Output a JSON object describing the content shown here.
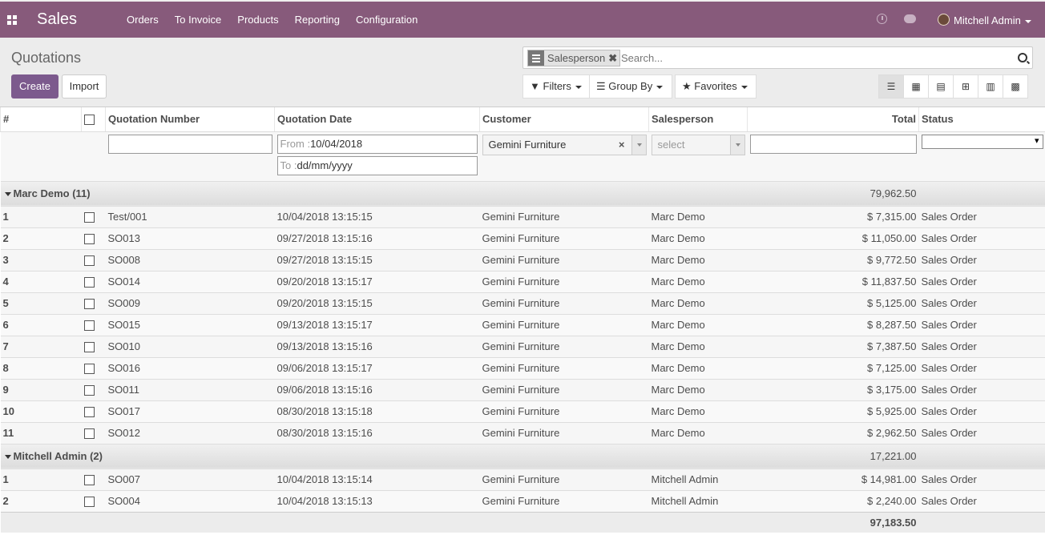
{
  "app": {
    "name": "Sales",
    "menu": [
      "Orders",
      "To Invoice",
      "Products",
      "Reporting",
      "Configuration"
    ],
    "user": "Mitchell Admin"
  },
  "page": {
    "title": "Quotations",
    "create": "Create",
    "import": "Import"
  },
  "search": {
    "facet": "Salesperson",
    "placeholder": "Search..."
  },
  "filters": {
    "filters": "Filters",
    "group_by": "Group By",
    "favorites": "Favorites"
  },
  "columns": {
    "num": "#",
    "number": "Quotation Number",
    "date": "Quotation Date",
    "customer": "Customer",
    "salesperson": "Salesperson",
    "total": "Total",
    "status": "Status"
  },
  "filter_row": {
    "from_label": "From :",
    "from_value": "10/04/2018",
    "to_label": "To :",
    "to_placeholder": "dd/mm/yyyy",
    "customer": "Gemini Furniture",
    "salesperson_placeholder": "select"
  },
  "groups": [
    {
      "name": "Marc Demo (11)",
      "total": "79,962.50",
      "rows": [
        {
          "n": "1",
          "ref": "Test/001",
          "date": "10/04/2018 13:15:15",
          "customer": "Gemini Furniture",
          "sp": "Marc Demo",
          "total": "$ 7,315.00",
          "status": "Sales Order"
        },
        {
          "n": "2",
          "ref": "SO013",
          "date": "09/27/2018 13:15:16",
          "customer": "Gemini Furniture",
          "sp": "Marc Demo",
          "total": "$ 11,050.00",
          "status": "Sales Order"
        },
        {
          "n": "3",
          "ref": "SO008",
          "date": "09/27/2018 13:15:15",
          "customer": "Gemini Furniture",
          "sp": "Marc Demo",
          "total": "$ 9,772.50",
          "status": "Sales Order"
        },
        {
          "n": "4",
          "ref": "SO014",
          "date": "09/20/2018 13:15:17",
          "customer": "Gemini Furniture",
          "sp": "Marc Demo",
          "total": "$ 11,837.50",
          "status": "Sales Order"
        },
        {
          "n": "5",
          "ref": "SO009",
          "date": "09/20/2018 13:15:15",
          "customer": "Gemini Furniture",
          "sp": "Marc Demo",
          "total": "$ 5,125.00",
          "status": "Sales Order"
        },
        {
          "n": "6",
          "ref": "SO015",
          "date": "09/13/2018 13:15:17",
          "customer": "Gemini Furniture",
          "sp": "Marc Demo",
          "total": "$ 8,287.50",
          "status": "Sales Order"
        },
        {
          "n": "7",
          "ref": "SO010",
          "date": "09/13/2018 13:15:16",
          "customer": "Gemini Furniture",
          "sp": "Marc Demo",
          "total": "$ 7,387.50",
          "status": "Sales Order"
        },
        {
          "n": "8",
          "ref": "SO016",
          "date": "09/06/2018 13:15:17",
          "customer": "Gemini Furniture",
          "sp": "Marc Demo",
          "total": "$ 7,125.00",
          "status": "Sales Order"
        },
        {
          "n": "9",
          "ref": "SO011",
          "date": "09/06/2018 13:15:16",
          "customer": "Gemini Furniture",
          "sp": "Marc Demo",
          "total": "$ 3,175.00",
          "status": "Sales Order"
        },
        {
          "n": "10",
          "ref": "SO017",
          "date": "08/30/2018 13:15:18",
          "customer": "Gemini Furniture",
          "sp": "Marc Demo",
          "total": "$ 5,925.00",
          "status": "Sales Order"
        },
        {
          "n": "11",
          "ref": "SO012",
          "date": "08/30/2018 13:15:16",
          "customer": "Gemini Furniture",
          "sp": "Marc Demo",
          "total": "$ 2,962.50",
          "status": "Sales Order"
        }
      ]
    },
    {
      "name": "Mitchell Admin (2)",
      "total": "17,221.00",
      "rows": [
        {
          "n": "1",
          "ref": "SO007",
          "date": "10/04/2018 13:15:14",
          "customer": "Gemini Furniture",
          "sp": "Mitchell Admin",
          "total": "$ 14,981.00",
          "status": "Sales Order"
        },
        {
          "n": "2",
          "ref": "SO004",
          "date": "10/04/2018 13:15:13",
          "customer": "Gemini Furniture",
          "sp": "Mitchell Admin",
          "total": "$ 2,240.00",
          "status": "Sales Order"
        }
      ]
    }
  ],
  "grand_total": "97,183.50",
  "colors": {
    "brand": "#875A7B",
    "primary_button": "#7C5A8D"
  }
}
